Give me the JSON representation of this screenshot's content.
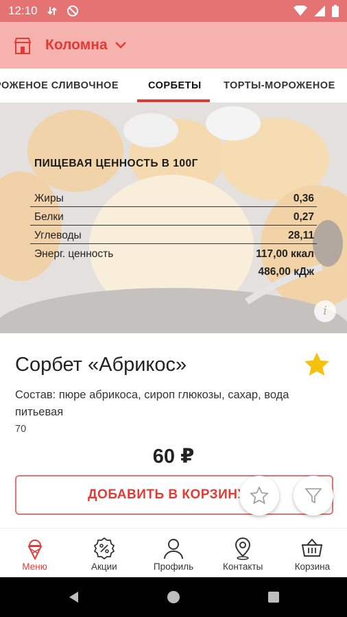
{
  "status_bar": {
    "time": "12:10"
  },
  "header": {
    "city": "Коломна",
    "icons": [
      "store-icon",
      "chevron-down-icon"
    ]
  },
  "tabs": [
    {
      "label": "МОРОЖЕНОЕ СЛИВОЧНОЕ",
      "visible_label": "РОЖЕНОЕ СЛИВОЧНОЕ",
      "active": false
    },
    {
      "label": "СОРБЕТЫ",
      "active": true
    },
    {
      "label": "ТОРТЫ-МОРОЖЕНОЕ",
      "active": false
    }
  ],
  "nutrition": {
    "title": "ПИЩЕВАЯ ЦЕННОСТЬ В 100Г",
    "rows": [
      {
        "label": "Жиры",
        "value": "0,36"
      },
      {
        "label": "Белки",
        "value": "0,27"
      },
      {
        "label": "Углеводы",
        "value": "28,11"
      }
    ],
    "energy_label": "Энерг. ценность",
    "energy_kcal": "117,00 ккал",
    "energy_kj": "486,00 кДж"
  },
  "product": {
    "name": "Сорбет «Абрикос»",
    "composition": "Состав: пюре абрикоса, сироп глюкозы, сахар, вода питьевая",
    "weight": "70",
    "price": "60 ₽",
    "favorite": true,
    "add_button": "ДОБАВИТЬ В КОРЗИНУ"
  },
  "bottom_nav": [
    {
      "label": "Меню",
      "icon": "ice-cream-icon",
      "active": true
    },
    {
      "label": "Акции",
      "icon": "percent-badge-icon",
      "active": false
    },
    {
      "label": "Профиль",
      "icon": "user-icon",
      "active": false
    },
    {
      "label": "Контакты",
      "icon": "location-pin-icon",
      "active": false
    },
    {
      "label": "Корзина",
      "icon": "basket-icon",
      "active": false
    }
  ],
  "colors": {
    "accent": "#e53935",
    "header_bg": "#f6b3ad",
    "status_bar": "#e57373",
    "star": "#f4c20d"
  }
}
